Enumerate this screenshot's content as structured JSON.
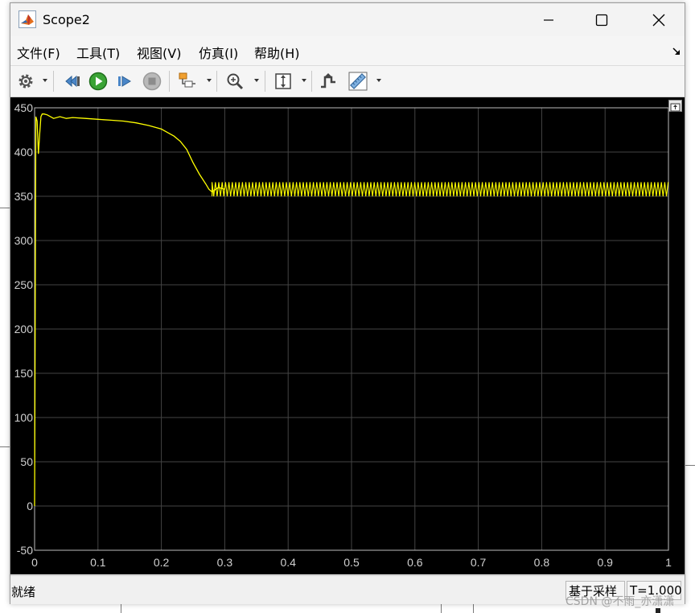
{
  "window": {
    "title": "Scope2"
  },
  "menu": {
    "items": [
      "文件(F)",
      "工具(T)",
      "视图(V)",
      "仿真(I)",
      "帮助(H)"
    ]
  },
  "toolbar": {
    "buttons": [
      {
        "name": "settings-icon"
      },
      {
        "name": "step-back-icon"
      },
      {
        "name": "run-icon"
      },
      {
        "name": "step-forward-icon"
      },
      {
        "name": "stop-icon"
      },
      {
        "name": "highlight-block-icon"
      },
      {
        "name": "zoom-in-icon"
      },
      {
        "name": "scale-axes-icon"
      },
      {
        "name": "triggers-icon"
      },
      {
        "name": "measure-icon"
      }
    ]
  },
  "status": {
    "left": "就绪",
    "sample_mode": "基于采样",
    "time": "T=1.000"
  },
  "watermark": "CSDN @不雨_亦潇潇",
  "colors": {
    "plot_background": "#000000",
    "signal": "#ffff00",
    "grid": "#444444",
    "tick_text": "#d0d0d0"
  },
  "chart_data": {
    "type": "line",
    "xlim": [
      0,
      1
    ],
    "ylim": [
      -50,
      450
    ],
    "x_ticks": [
      "0",
      "0.1",
      "0.2",
      "0.3",
      "0.4",
      "0.5",
      "0.6",
      "0.7",
      "0.8",
      "0.9",
      "1"
    ],
    "y_ticks": [
      "450",
      "400",
      "350",
      "300",
      "250",
      "200",
      "150",
      "100",
      "50",
      "0",
      "-50"
    ],
    "grid": true,
    "series": [
      {
        "x": [
          0,
          0.002,
          0.004,
          0.006,
          0.008,
          0.01,
          0.012,
          0.015,
          0.02,
          0.03,
          0.04,
          0.05,
          0.06,
          0.08,
          0.1,
          0.12,
          0.14,
          0.16,
          0.18,
          0.2,
          0.21,
          0.22,
          0.23,
          0.24,
          0.25,
          0.26,
          0.27,
          0.275,
          0.28,
          0.29,
          0.3
        ],
        "y": [
          0,
          440,
          435,
          398,
          420,
          440,
          443,
          443,
          442,
          438,
          440,
          438,
          439,
          438,
          437,
          436,
          435,
          433,
          430,
          426,
          422,
          418,
          412,
          403,
          388,
          375,
          364,
          358,
          355,
          360,
          358
        ],
        "oscillation": {
          "x_start": 0.28,
          "x_end": 1.0,
          "y_min": 350,
          "y_max": 366
        }
      }
    ]
  }
}
